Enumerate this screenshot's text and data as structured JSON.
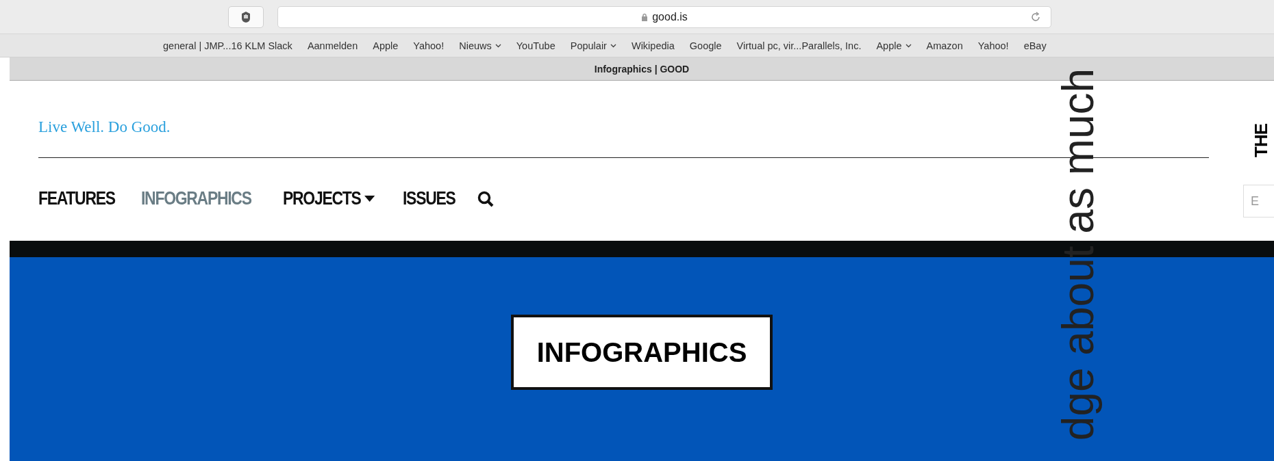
{
  "browser": {
    "address": "good.is",
    "bookmarks": [
      {
        "label": "general | JMP...16 KLM Slack",
        "dropdown": false
      },
      {
        "label": "Aanmelden",
        "dropdown": false
      },
      {
        "label": "Apple",
        "dropdown": false
      },
      {
        "label": "Yahoo!",
        "dropdown": false
      },
      {
        "label": "Nieuws",
        "dropdown": true
      },
      {
        "label": "YouTube",
        "dropdown": false
      },
      {
        "label": "Populair",
        "dropdown": true
      },
      {
        "label": "Wikipedia",
        "dropdown": false
      },
      {
        "label": "Google",
        "dropdown": false
      },
      {
        "label": "Virtual pc, vir...Parallels, Inc.",
        "dropdown": false
      },
      {
        "label": "Apple",
        "dropdown": true
      },
      {
        "label": "Amazon",
        "dropdown": false
      },
      {
        "label": "Yahoo!",
        "dropdown": false
      },
      {
        "label": "eBay",
        "dropdown": false
      }
    ],
    "tab_title": "Infographics | GOOD"
  },
  "page": {
    "tagline": "Live Well. Do Good.",
    "nav": [
      {
        "label": "FEATURES",
        "selected": false,
        "dropdown": false
      },
      {
        "label": "INFOGRAPHICS",
        "selected": true,
        "dropdown": false
      },
      {
        "label": "PROJECTS",
        "selected": false,
        "dropdown": true
      },
      {
        "label": "ISSUES",
        "selected": false,
        "dropdown": false
      }
    ],
    "side_heading": "THE",
    "side_field": {
      "placeholder": "E"
    },
    "banner_title": "INFOGRAPHICS"
  },
  "overlay_text": "dge about as much"
}
